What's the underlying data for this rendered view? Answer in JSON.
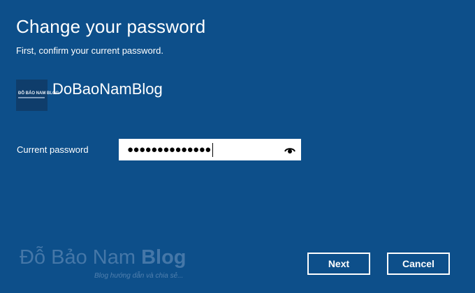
{
  "dialog": {
    "title": "Change your password",
    "subtitle": "First, confirm your current password."
  },
  "account": {
    "name": "DoBaoNamBlog",
    "logo_text": "ĐỖ BẢO NAM BLOG"
  },
  "form": {
    "current_password_label": "Current password",
    "current_password_value": "●●●●●●●●●●●●●●",
    "reveal_icon": "eye-icon"
  },
  "watermark": {
    "title_regular": "Đỗ Bảo Nam ",
    "title_bold": "Blog",
    "tagline": "Blog hướng dẫn và chia sẻ..."
  },
  "buttons": {
    "next_label": "Next",
    "cancel_label": "Cancel"
  },
  "colors": {
    "background": "#0d4f8a",
    "text": "#ffffff",
    "input_background": "#ffffff"
  }
}
